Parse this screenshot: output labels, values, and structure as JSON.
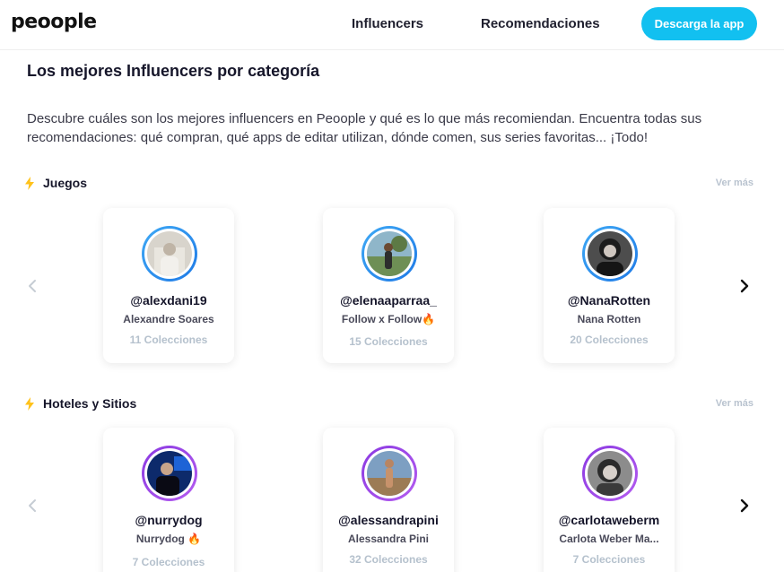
{
  "header": {
    "logo": "peoople",
    "nav": [
      "Influencers",
      "Recomendaciones"
    ],
    "cta_label": "Descarga la app",
    "cta_color": "#12c0f0"
  },
  "main": {
    "title": "Los mejores Influencers por categoría",
    "intro": "Descubre cuáles son los mejores influencers en Peoople y qué es lo que más recomiendan. Encuentra todas sus recomendaciones: qué compran, qué apps de editar utilizan, dónde comen, sus series favoritas... ¡Todo!",
    "sections": [
      {
        "title": "Juegos",
        "ver_mas": "Ver más",
        "icon": "lightning-bolt-icon",
        "cards": [
          {
            "handle": "@alexdani19",
            "name": "Alexandre Soares",
            "collections": "11 Colecciones"
          },
          {
            "handle": "@elenaaparraa_",
            "name": "Follow x Follow🔥",
            "collections": "15 Colecciones"
          },
          {
            "handle": "@NanaRotten",
            "name": "Nana Rotten",
            "collections": "20 Colecciones"
          }
        ]
      },
      {
        "title": "Hoteles y Sitios",
        "ver_mas": "Ver más",
        "icon": "lightning-bolt-icon",
        "cards": [
          {
            "handle": "@nurrydog",
            "name": "Nurrydog 🔥",
            "collections": "7 Colecciones"
          },
          {
            "handle": "@alessandrapini",
            "name": "Alessandra Pini",
            "collections": "32 Colecciones"
          },
          {
            "handle": "@carlotaweberm",
            "name": "Carlota Weber Ma...",
            "collections": "7 Colecciones"
          }
        ]
      }
    ]
  },
  "colors": {
    "bolt": "#ffc21a",
    "ring_blue": "#2a8ff0",
    "ring_purple": "#9a45e8",
    "muted_text": "#b5c1cd"
  }
}
